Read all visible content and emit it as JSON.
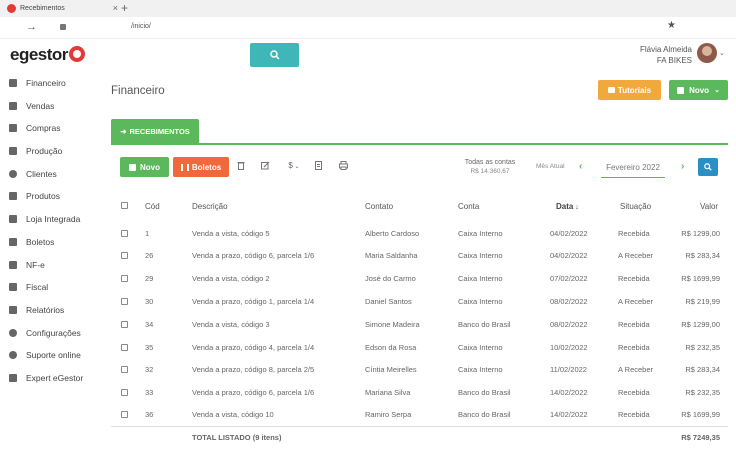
{
  "browser": {
    "tab_title": "Recebimentos",
    "tab_close": "×",
    "new_tab": "+",
    "url": "/inicio/",
    "back": "→",
    "star": "★"
  },
  "header": {
    "logo_text": "egestor",
    "user_name": "Flávia Almeida",
    "company": "FA BIKES",
    "user_caret": "⌄"
  },
  "sidebar": {
    "items": [
      {
        "label": "Financeiro",
        "icon": "dollar-icon"
      },
      {
        "label": "Vendas",
        "icon": "cart-icon"
      },
      {
        "label": "Compras",
        "icon": "basket-icon"
      },
      {
        "label": "Produção",
        "icon": "factory-icon"
      },
      {
        "label": "Clientes",
        "icon": "users-icon"
      },
      {
        "label": "Produtos",
        "icon": "boxes-icon"
      },
      {
        "label": "Loja Integrada",
        "icon": "store-icon"
      },
      {
        "label": "Boletos",
        "icon": "barcode-icon"
      },
      {
        "label": "NF-e",
        "icon": "document-icon"
      },
      {
        "label": "Fiscal",
        "icon": "file-icon"
      },
      {
        "label": "Relatórios",
        "icon": "chart-icon"
      },
      {
        "label": "Configurações",
        "icon": "gear-icon"
      },
      {
        "label": "Suporte online",
        "icon": "support-icon"
      },
      {
        "label": "Expert eGestor",
        "icon": "graduation-icon"
      }
    ]
  },
  "main": {
    "title": "Financeiro",
    "tutoriais": "Tutoriais",
    "novo_top": "Novo",
    "tab_label": "RECEBIMENTOS",
    "novo": "Novo",
    "boletos": "Boletos",
    "currency_menu": "$",
    "totals_label": "Todas as contas",
    "totals_value": "R$ 14.360,67",
    "mes_atual": "Mês Atual",
    "month": "Fevereiro 2022",
    "prev": "‹",
    "next": "›"
  },
  "table": {
    "headers": {
      "cod": "Cód",
      "descricao": "Descrição",
      "contato": "Contato",
      "conta": "Conta",
      "data": "Data",
      "situacao": "Situação",
      "valor": "Valor"
    },
    "rows": [
      {
        "cod": "1",
        "descricao": "Venda a vista, código 5",
        "contato": "Alberto Cardoso",
        "conta": "Caixa Interno",
        "data": "04/02/2022",
        "situacao": "Recebida",
        "valor": "R$ 1299,00"
      },
      {
        "cod": "26",
        "descricao": "Venda a prazo, código 6, parcela 1/6",
        "contato": "Maria Saldanha",
        "conta": "Caixa Interno",
        "data": "04/02/2022",
        "situacao": "A Receber",
        "valor": "R$ 283,34"
      },
      {
        "cod": "29",
        "descricao": "Venda a vista, código 2",
        "contato": "José do Carmo",
        "conta": "Caixa Interno",
        "data": "07/02/2022",
        "situacao": "Recebida",
        "valor": "R$ 1699,99"
      },
      {
        "cod": "30",
        "descricao": "Venda a prazo, código 1, parcela 1/4",
        "contato": "Daniel Santos",
        "conta": "Caixa Interno",
        "data": "08/02/2022",
        "situacao": "A Receber",
        "valor": "R$ 219,99"
      },
      {
        "cod": "34",
        "descricao": "Venda a vista, código 3",
        "contato": "Simone Madeira",
        "conta": "Banco do Brasil",
        "data": "08/02/2022",
        "situacao": "Recebida",
        "valor": "R$ 1299,00"
      },
      {
        "cod": "35",
        "descricao": "Venda a prazo, código 4, parcela 1/4",
        "contato": "Edson da Rosa",
        "conta": "Caixa Interno",
        "data": "10/02/2022",
        "situacao": "Recebida",
        "valor": "R$ 232,35"
      },
      {
        "cod": "32",
        "descricao": "Venda a prazo, código 8, parcela 2/5",
        "contato": "Cíntia Meirelles",
        "conta": "Caixa Interno",
        "data": "11/02/2022",
        "situacao": "A Receber",
        "valor": "R$ 283,34"
      },
      {
        "cod": "33",
        "descricao": "Venda a prazo, código 6, parcela 1/6",
        "contato": "Mariana Silva",
        "conta": "Banco do Brasil",
        "data": "14/02/2022",
        "situacao": "Recebida",
        "valor": "R$ 232,35"
      },
      {
        "cod": "36",
        "descricao": "Venda a vista, código 10",
        "contato": "Ramiro Serpa",
        "conta": "Banco do Brasil",
        "data": "14/02/2022",
        "situacao": "Recebida",
        "valor": "R$ 1699,99"
      }
    ],
    "total_label": "TOTAL LISTADO (9 itens)",
    "total_value": "R$ 7249,35"
  },
  "colors": {
    "green": "#5cb85c",
    "orange": "#f0693a",
    "amber": "#f2a93b",
    "teal": "#3fb7b9",
    "blue": "#2a8fc4",
    "brand_red": "#e53935"
  }
}
